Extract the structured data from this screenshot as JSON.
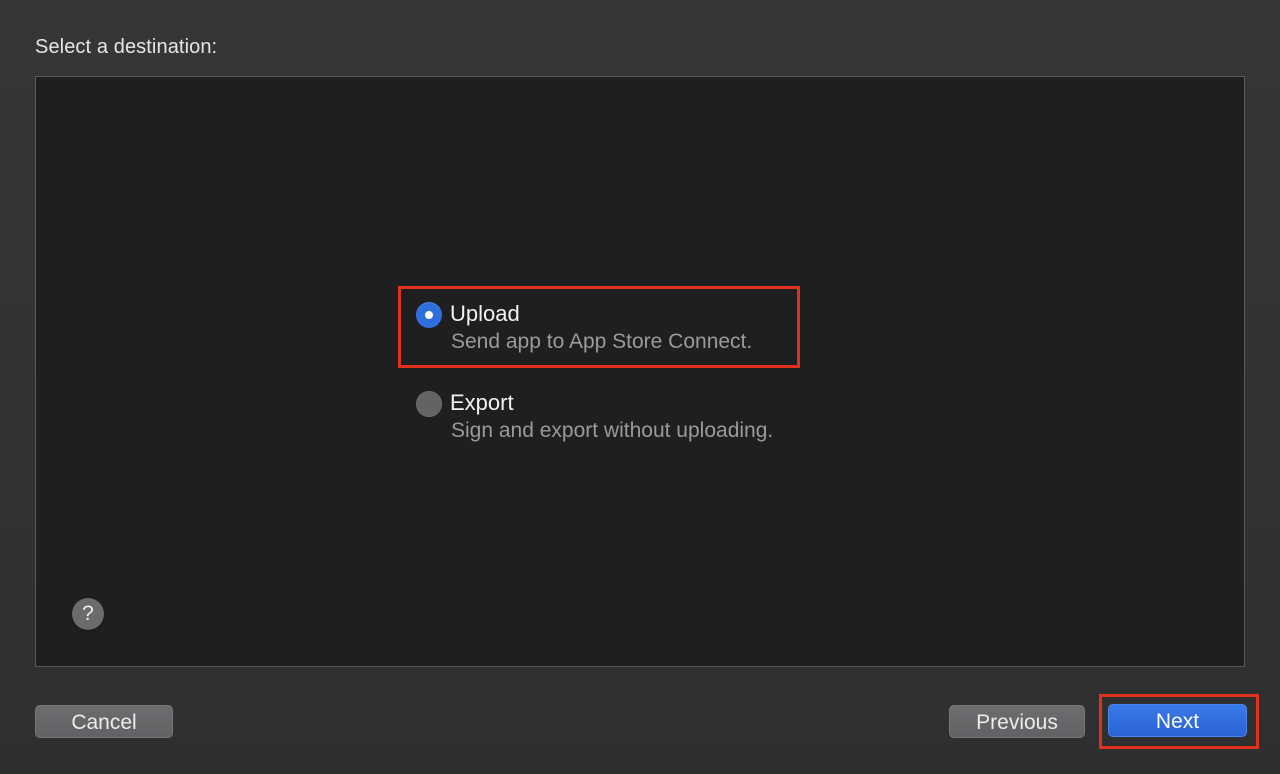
{
  "dialog": {
    "heading": "Select a destination:"
  },
  "options": [
    {
      "title": "Upload",
      "description": "Send app to App Store Connect.",
      "selected": true
    },
    {
      "title": "Export",
      "description": "Sign and export without uploading.",
      "selected": false
    }
  ],
  "help": {
    "glyph": "?",
    "icon": "help-icon"
  },
  "buttons": {
    "cancel": "Cancel",
    "previous": "Previous",
    "next": "Next"
  },
  "colors": {
    "accent": "#2f6fdd",
    "highlight": "#e0301e",
    "panel_background": "#1f1f21"
  }
}
